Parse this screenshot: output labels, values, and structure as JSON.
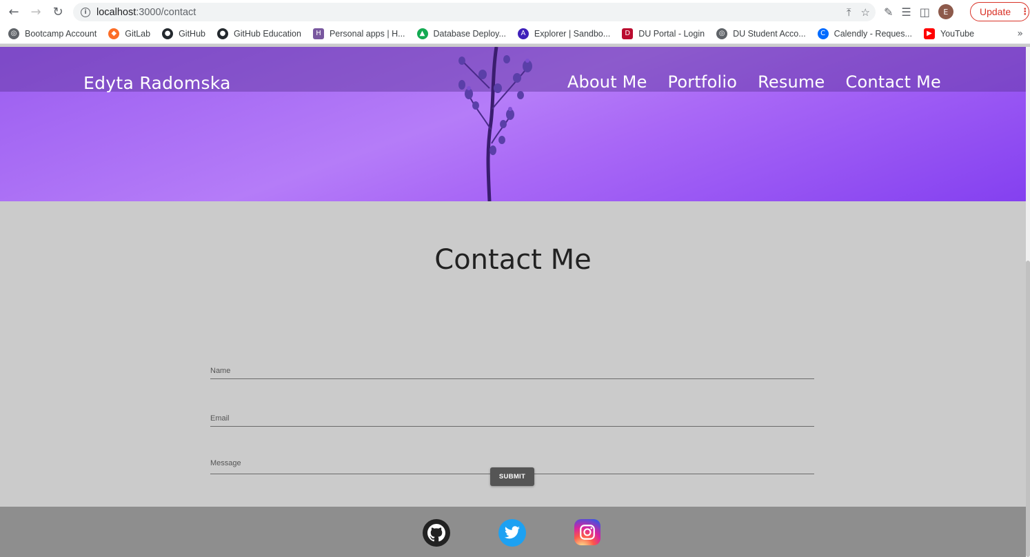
{
  "browser": {
    "url_host": "localhost",
    "url_path": ":3000/contact",
    "update_label": "Update",
    "avatar_letter": "E",
    "bookmarks": [
      {
        "label": "Bootcamp Account",
        "icon": "globe-icon",
        "color": "#5f6368"
      },
      {
        "label": "GitLab",
        "icon": "gitlab-icon",
        "color": "#fc6d26"
      },
      {
        "label": "GitHub",
        "icon": "github-icon",
        "color": "#24292e"
      },
      {
        "label": "GitHub Education",
        "icon": "github-icon",
        "color": "#24292e"
      },
      {
        "label": "Personal apps | H...",
        "icon": "heroku-icon",
        "color": "#79589f"
      },
      {
        "label": "Database Deploy...",
        "icon": "mongodb-icon",
        "color": "#13aa52"
      },
      {
        "label": "Explorer | Sandbo...",
        "icon": "apollo-icon",
        "color": "#3f20ba"
      },
      {
        "label": "DU Portal - Login",
        "icon": "du-icon",
        "color": "#ba0c2f"
      },
      {
        "label": "DU Student Acco...",
        "icon": "globe-icon",
        "color": "#5f6368"
      },
      {
        "label": "Calendly - Reques...",
        "icon": "calendly-icon",
        "color": "#006bff"
      },
      {
        "label": "YouTube",
        "icon": "youtube-icon",
        "color": "#ff0000"
      }
    ]
  },
  "site": {
    "brand": "Edyta Radomska",
    "nav": [
      "About Me",
      "Portfolio",
      "Resume",
      "Contact Me"
    ]
  },
  "contact": {
    "title": "Contact Me",
    "name_placeholder": "Name",
    "email_placeholder": "Email",
    "message_placeholder": "Message",
    "submit_label": "SUBMIT"
  },
  "footer": {
    "icons": [
      "github-icon",
      "twitter-icon",
      "instagram-icon"
    ]
  },
  "colors": {
    "hero": "#a968f6",
    "content_bg": "#cbcbcb",
    "footer_bg": "#8e8e8e",
    "button_bg": "#555555"
  }
}
